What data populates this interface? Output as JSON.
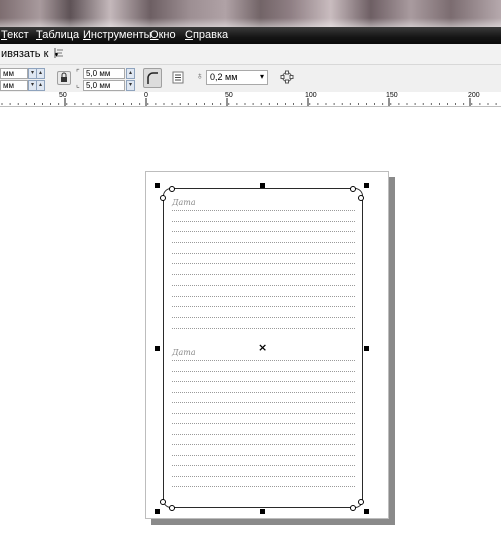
{
  "menu": {
    "items": [
      {
        "first": "Т",
        "rest": "екст"
      },
      {
        "first": "Т",
        "rest": "аблица"
      },
      {
        "first": "И",
        "rest": "нструменты"
      },
      {
        "first": "О",
        "rest": "кно"
      },
      {
        "first": "С",
        "rest": "правка"
      }
    ]
  },
  "toolbar1": {
    "snap_label": "ивязать к",
    "snap_arrow": "▾"
  },
  "toolbar2": {
    "unit_top": "мм",
    "unit_bottom": "мм",
    "radius_top": "5,0 мм",
    "radius_bottom": "5,0 мм",
    "outline_width": "0,2 мм"
  },
  "ruler": {
    "labels": [
      "50",
      "0",
      "50",
      "100",
      "150",
      "200"
    ]
  },
  "document": {
    "section_label_top": "Дата",
    "section_label_bottom": "Дата"
  },
  "colors": {
    "menubar_bg": "#151515",
    "page_shadow": "#8a8a8a"
  }
}
